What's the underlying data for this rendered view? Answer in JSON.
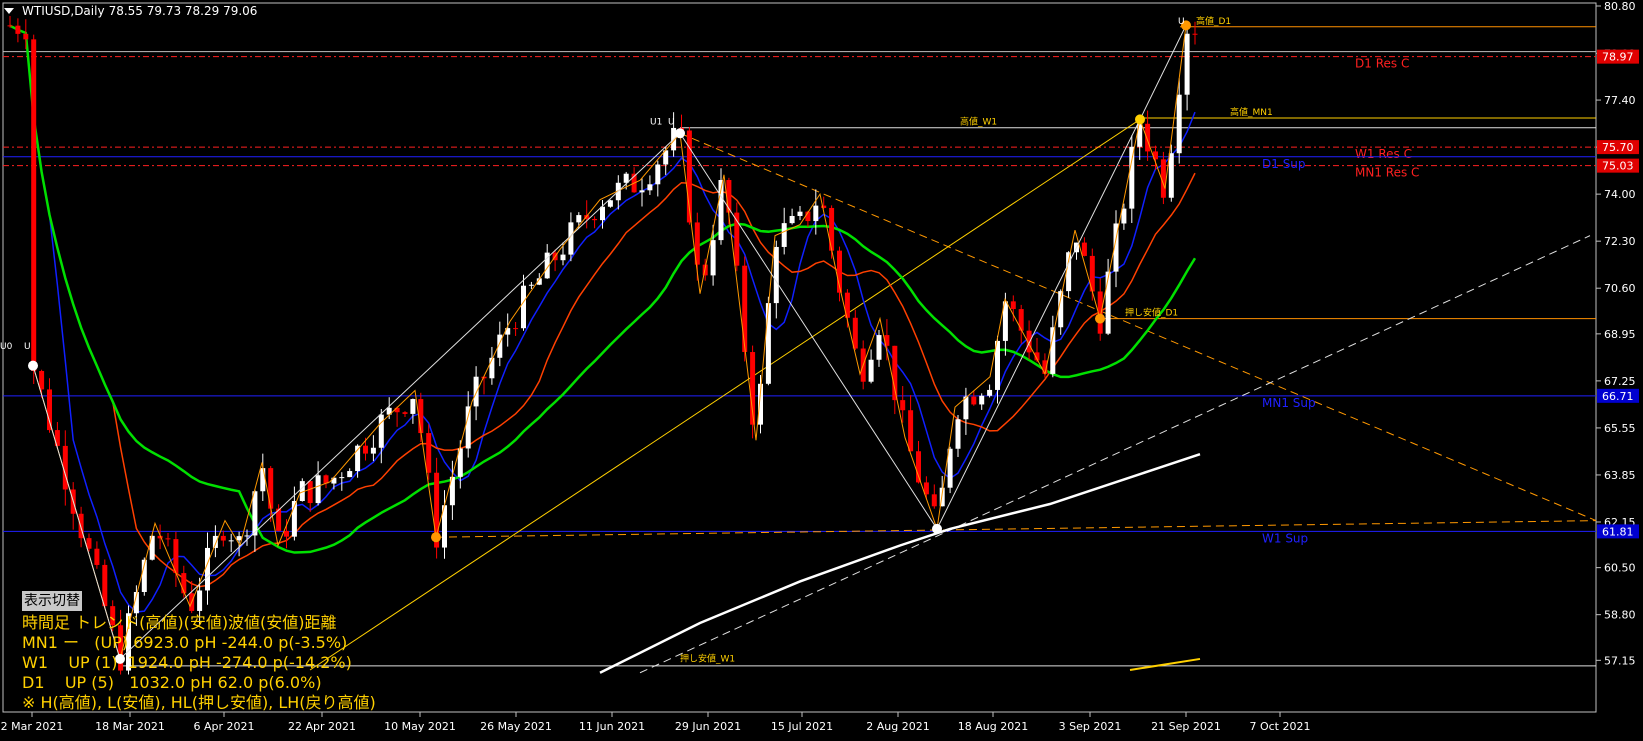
{
  "header": {
    "symbol": "WTIUSD,Daily",
    "ohlc": "78.55 79.73 78.29 79.06"
  },
  "info_panel": {
    "toggle_label": "表示切替",
    "lines": [
      "時間足 トレンド(高値)(安値)波値(安値)距離",
      "MN1 ー   (UP) 6923.0 pH -244.0 p(-3.5%)",
      "W1    UP (1)  1924.0 pH -274.0 p(-14.2%)",
      "D1    UP (5)   1032.0 pH 62.0 p(6.0%)",
      "※ H(高値), L(安値), HL(押し安値), LH(戻り高値)"
    ]
  },
  "chart_data": {
    "type": "candlestick",
    "title": "WTIUSD,Daily",
    "ylim": [
      56.8,
      80.8
    ],
    "y_ticks": [
      "80.80",
      "79.09",
      "77.40",
      "75.70",
      "74.00",
      "72.30",
      "70.60",
      "68.95",
      "67.25",
      "65.55",
      "63.85",
      "62.15",
      "60.50",
      "58.80",
      "57.15"
    ],
    "x_ticks": [
      "2 Mar 2021",
      "18 Mar 2021",
      "6 Apr 2021",
      "22 Apr 2021",
      "10 May 2021",
      "26 May 2021",
      "11 Jun 2021",
      "29 Jun 2021",
      "15 Jul 2021",
      "2 Aug 2021",
      "18 Aug 2021",
      "3 Sep 2021",
      "21 Sep 2021",
      "7 Oct 2021"
    ],
    "price_badges": [
      {
        "value": "78.97",
        "color": "#e00000"
      },
      {
        "value": "75.70",
        "color": "#e00000"
      },
      {
        "value": "75.03",
        "color": "#e00000"
      },
      {
        "value": "66.71",
        "color": "#0000d0"
      },
      {
        "value": "61.81",
        "color": "#0000d0"
      }
    ],
    "levels": [
      {
        "name": "D1 Res C",
        "value": 78.97,
        "color": "#ff2020"
      },
      {
        "name": "W1 Res C",
        "value": 75.7,
        "color": "#ff2020"
      },
      {
        "name": "MN1 Res C",
        "value": 75.03,
        "color": "#ff2020"
      },
      {
        "name": "D1 Sup",
        "value": 75.35,
        "color": "#2020ff"
      },
      {
        "name": "MN1 Sup",
        "value": 66.71,
        "color": "#2020ff"
      },
      {
        "name": "W1 Sup",
        "value": 61.81,
        "color": "#2020ff"
      }
    ],
    "tags": [
      {
        "text": "高値_D1",
        "x": 1196,
        "y": 80.05
      },
      {
        "text": "高値_MN1",
        "x": 1230,
        "y": 76.75
      },
      {
        "text": "高値_W1",
        "x": 960,
        "y": 76.4
      },
      {
        "text": "押し安値_D1",
        "x": 1125,
        "y": 69.5
      },
      {
        "text": "押し安値_W1",
        "x": 680,
        "y": 57.0
      },
      {
        "text": "U1",
        "x": 650,
        "y": 76.4
      },
      {
        "text": "U",
        "x": 668,
        "y": 76.4
      },
      {
        "text": "U",
        "x": 1178,
        "y": 80.05
      },
      {
        "text": "U0",
        "x": 0,
        "y": 68.3
      },
      {
        "text": "U",
        "x": 24,
        "y": 68.3
      }
    ],
    "zigzag_points": [
      [
        33,
        67.8
      ],
      [
        120,
        57.2
      ],
      [
        155,
        62.1
      ],
      [
        190,
        59.1
      ],
      [
        225,
        62.2
      ],
      [
        240,
        61.3
      ],
      [
        262,
        64.3
      ],
      [
        278,
        61.3
      ],
      [
        300,
        63.2
      ],
      [
        330,
        63.6
      ],
      [
        380,
        65.7
      ],
      [
        415,
        66.9
      ],
      [
        436,
        61.6
      ],
      [
        472,
        66.5
      ],
      [
        510,
        69.4
      ],
      [
        560,
        72.0
      ],
      [
        600,
        73.8
      ],
      [
        640,
        74.5
      ],
      [
        680,
        76.2
      ],
      [
        700,
        70.4
      ],
      [
        724,
        74.7
      ],
      [
        756,
        65.1
      ],
      [
        775,
        72.5
      ],
      [
        800,
        72.9
      ],
      [
        820,
        74.0
      ],
      [
        838,
        70.9
      ],
      [
        860,
        67.5
      ],
      [
        880,
        69.5
      ],
      [
        905,
        65.2
      ],
      [
        937,
        61.9
      ],
      [
        955,
        66.3
      ],
      [
        990,
        67.4
      ],
      [
        1005,
        70.2
      ],
      [
        1045,
        67.5
      ],
      [
        1075,
        72.7
      ],
      [
        1100,
        69.5
      ],
      [
        1140,
        76.7
      ],
      [
        1165,
        74.2
      ],
      [
        1186,
        80.1
      ]
    ]
  }
}
